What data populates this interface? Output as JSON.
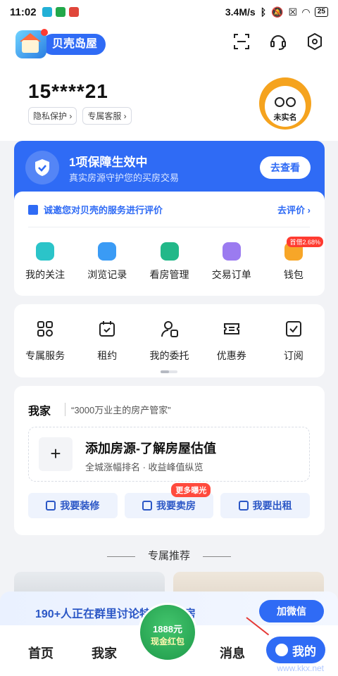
{
  "status": {
    "time": "11:02",
    "network": "3.4M/s",
    "battery": "25"
  },
  "header": {
    "logo_text": "贝壳岛屋"
  },
  "profile": {
    "phone": "15****21",
    "chips": [
      "隐私保护 ›",
      "专属客服 ›"
    ],
    "avatar_label": "未实名"
  },
  "guard": {
    "title": "1项保障生效中",
    "subtitle": "真实房源守护您的买房交易",
    "button": "去查看"
  },
  "rating": {
    "text": "诚邀您对贝壳的服务进行评价",
    "link": "去评价 ›"
  },
  "grid1": [
    {
      "label": "我的关注",
      "color": "#2bc4c9"
    },
    {
      "label": "浏览记录",
      "color": "#3a9bf5"
    },
    {
      "label": "看房管理",
      "color": "#22b889"
    },
    {
      "label": "交易订单",
      "color": "#9b7bf0"
    },
    {
      "label": "钱包",
      "color": "#f7a628",
      "badge": "首借2.68%"
    }
  ],
  "grid2": [
    {
      "label": "专属服务"
    },
    {
      "label": "租约"
    },
    {
      "label": "我的委托"
    },
    {
      "label": "优惠券"
    },
    {
      "label": "订阅"
    }
  ],
  "home": {
    "title": "我家",
    "subtitle": "“3000万业主的房产管家”",
    "add_title": "添加房源-了解房屋估值",
    "add_sub": "全城涨幅排名 · 收益峰值纵览",
    "actions": [
      "我要装修",
      "我要卖房",
      "我要出租"
    ],
    "sell_tag": "更多曝光"
  },
  "recommend": {
    "title": "专属推荐"
  },
  "promo": {
    "text": "190+人正在群里讨论特价捡漏房",
    "button": "加微信"
  },
  "tabbar": {
    "home": "首页",
    "myhome": "我家",
    "redpack_a": "1888元",
    "redpack_b": "现金红包",
    "msg": "消息",
    "mine": "我的"
  },
  "watermark": "www.kkx.net"
}
